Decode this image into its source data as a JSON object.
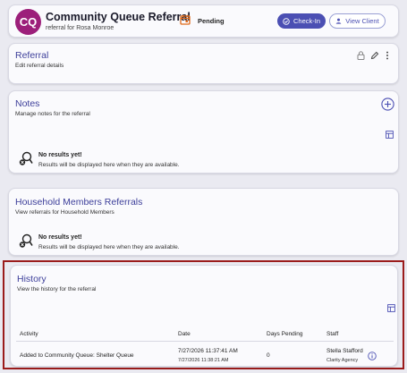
{
  "header": {
    "initials": "CQ",
    "title": "Community Queue Referral",
    "subtitle": "referral for Rosa Monroe",
    "status": "Pending",
    "checkin_label": "Check-In",
    "view_client_label": "View Client"
  },
  "referral": {
    "title": "Referral",
    "subtitle": "Edit referral details"
  },
  "notes": {
    "title": "Notes",
    "subtitle": "Manage notes for the referral",
    "empty_title": "No results yet!",
    "empty_sub": "Results will be displayed here when they are available."
  },
  "household": {
    "title": "Household Members Referrals",
    "subtitle": "View referrals for Household Members",
    "empty_title": "No results yet!",
    "empty_sub": "Results will be displayed here when they are available."
  },
  "history": {
    "title": "History",
    "subtitle": "View the history for the referral",
    "columns": [
      "Activity",
      "Date",
      "Days Pending",
      "Staff"
    ],
    "rows": [
      {
        "activity": "Added to Community Queue: Shelter Queue",
        "date": "7/27/2026 11:37:41 AM",
        "date_small": "7/27/2026 11:38:21 AM",
        "days_pending": "0",
        "staff": "Stella Stafford",
        "agency": "Clarity Agency"
      }
    ]
  },
  "colors": {
    "accent": "#4b4fb3",
    "avatar": "#9c1f7a",
    "status_icon": "#e06a1a",
    "highlight_border": "#9b1c1c"
  }
}
